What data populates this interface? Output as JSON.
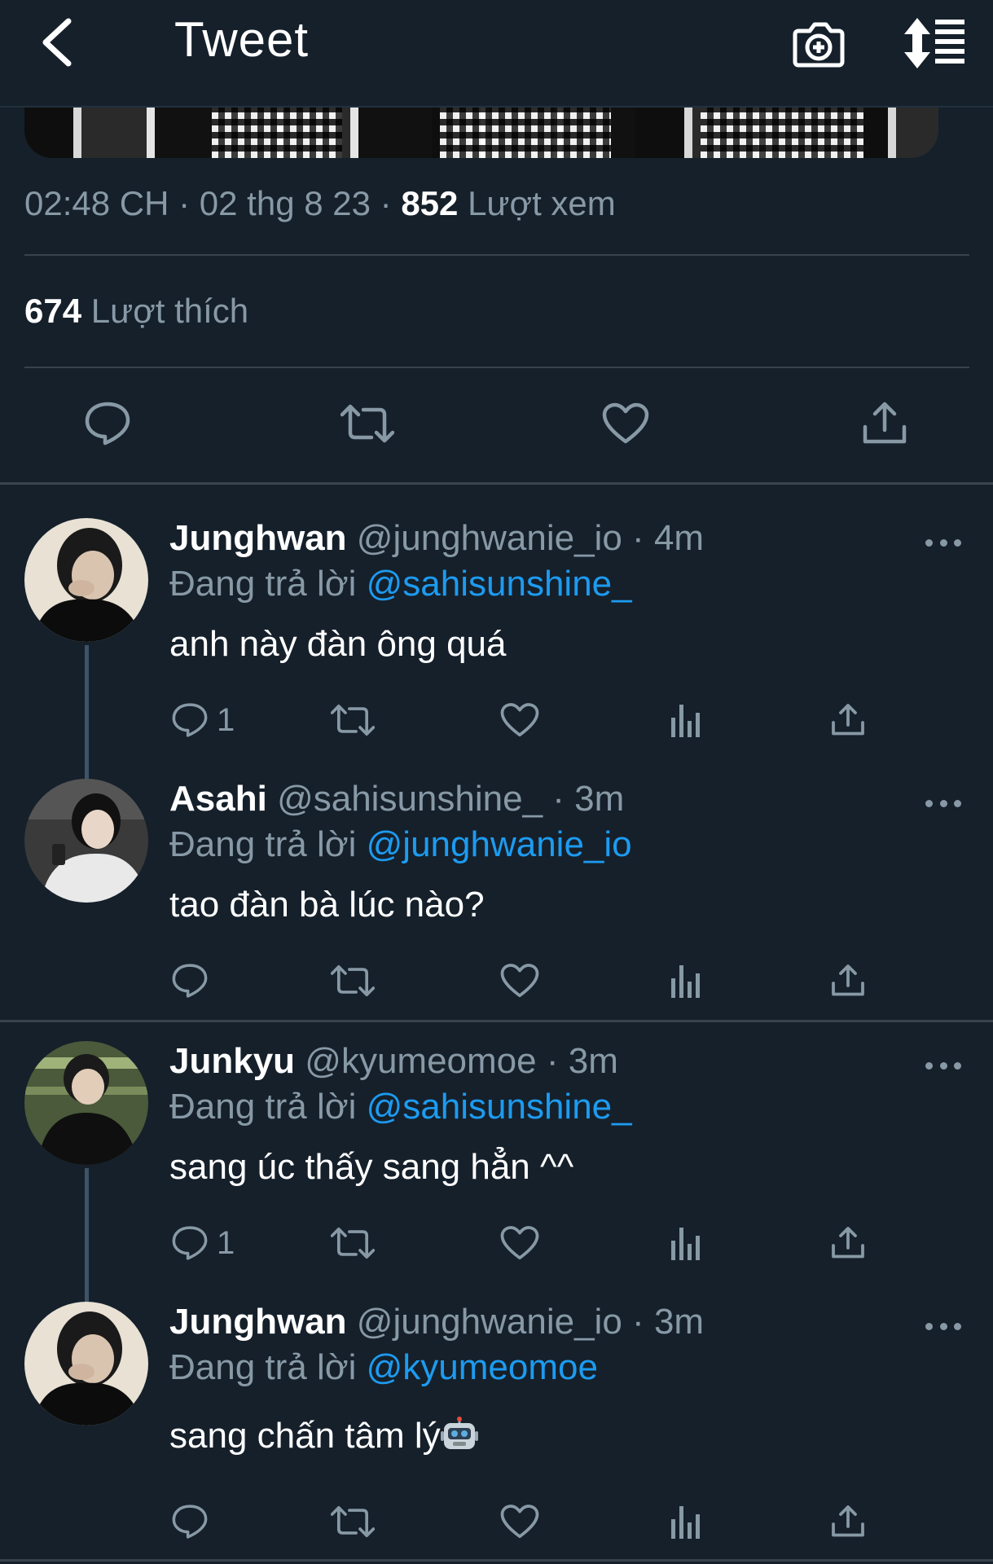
{
  "header": {
    "title": "Tweet",
    "icons": [
      "back-arrow-icon",
      "camera-plus-icon",
      "sort-timeline-icon"
    ]
  },
  "tweet": {
    "time": "02:48 CH",
    "date": "02 thg 8 23",
    "views_count": "852",
    "views_label": "Lượt xem",
    "likes_count": "674",
    "likes_label": "Lượt thích",
    "separator": "·"
  },
  "colors": {
    "background": "#15202b",
    "muted": "#8899a6",
    "mention": "#1d9bf0",
    "divider": "#38444d"
  },
  "replies": [
    {
      "name": "Junghwan",
      "handle": "@junghwanie_io",
      "age": "4m",
      "replying_prefix": "Đang trả lời",
      "replying_to": "@sahisunshine_",
      "text": "anh này đàn ông quá",
      "reply_count": "1"
    },
    {
      "name": "Asahi",
      "handle": "@sahisunshine_",
      "age": "3m",
      "replying_prefix": "Đang trả lời",
      "replying_to": "@junghwanie_io",
      "text": "tao đàn bà lúc nào?",
      "reply_count": ""
    },
    {
      "name": "Junkyu",
      "handle": "@kyumeomoe",
      "age": "3m",
      "replying_prefix": "Đang trả lời",
      "replying_to": "@sahisunshine_",
      "text": "sang úc thấy sang hẳn ^^",
      "reply_count": "1"
    },
    {
      "name": "Junghwan",
      "handle": "@junghwanie_io",
      "age": "3m",
      "replying_prefix": "Đang trả lời",
      "replying_to": "@kyumeomoe",
      "text": "sang chấn tâm lý",
      "emoji": "robot-face-emoji",
      "reply_count": ""
    }
  ]
}
